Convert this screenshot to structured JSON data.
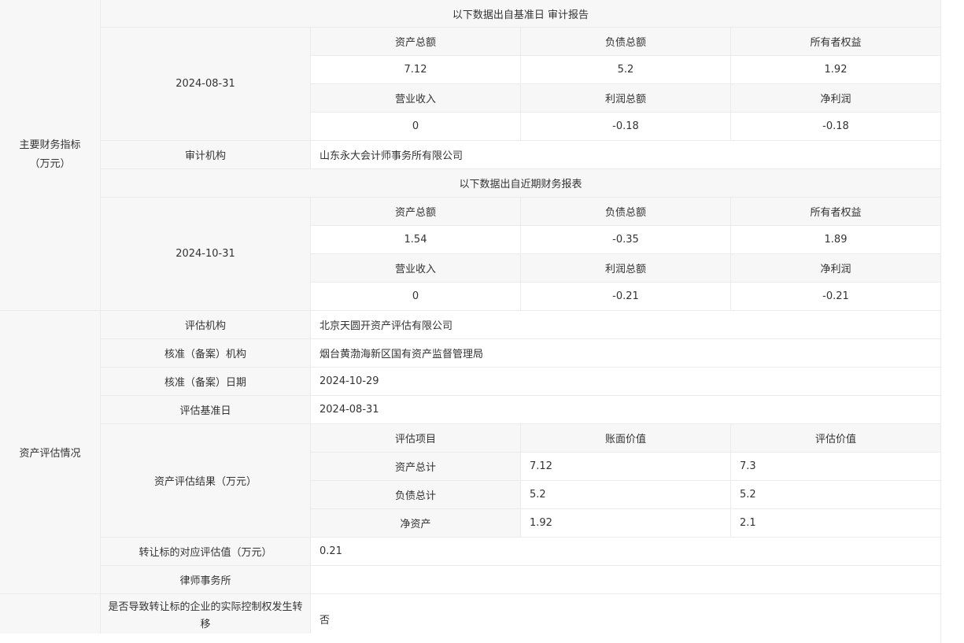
{
  "financial": {
    "category_line1": "主要财务指标",
    "category_line2": "（万元）",
    "audit_section": {
      "header": "以下数据出自基准日 审计报告",
      "date": "2024-08-31",
      "row1_labels": [
        "资产总额",
        "负债总额",
        "所有者权益"
      ],
      "row1_values": [
        "7.12",
        "5.2",
        "1.92"
      ],
      "row2_labels": [
        "营业收入",
        "利润总额",
        "净利润"
      ],
      "row2_values": [
        "0",
        "-0.18",
        "-0.18"
      ],
      "auditor_label": "审计机构",
      "auditor_value": "山东永大会计师事务所有限公司"
    },
    "recent_section": {
      "header": "以下数据出自近期财务报表",
      "date": "2024-10-31",
      "row1_labels": [
        "资产总额",
        "负债总额",
        "所有者权益"
      ],
      "row1_values": [
        "1.54",
        "-0.35",
        "1.89"
      ],
      "row2_labels": [
        "营业收入",
        "利润总额",
        "净利润"
      ],
      "row2_values": [
        "0",
        "-0.21",
        "-0.21"
      ]
    }
  },
  "valuation": {
    "category": "资产评估情况",
    "org_label": "评估机构",
    "org_value": "北京天圆开资产评估有限公司",
    "approval_org_label": "核准（备案）机构",
    "approval_org_value": "烟台黄渤海新区国有资产监督管理局",
    "approval_date_label": "核准（备案）日期",
    "approval_date_value": "2024-10-29",
    "base_date_label": "评估基准日",
    "base_date_value": "2024-08-31",
    "result_label": "资产评估结果（万元）",
    "result_headers": [
      "评估项目",
      "账面价值",
      "评估价值"
    ],
    "result_rows": [
      {
        "item": "资产总计",
        "book": "7.12",
        "appraised": "7.3"
      },
      {
        "item": "负债总计",
        "book": "5.2",
        "appraised": "5.2"
      },
      {
        "item": "净资产",
        "book": "1.92",
        "appraised": "2.1"
      }
    ],
    "transfer_value_label": "转让标的对应评估值（万元）",
    "transfer_value": "0.21",
    "law_firm_label": "律师事务所",
    "law_firm_value": ""
  },
  "control": {
    "question_label": "是否导致转让标的企业的实际控制权发生转移",
    "answer": "否"
  }
}
